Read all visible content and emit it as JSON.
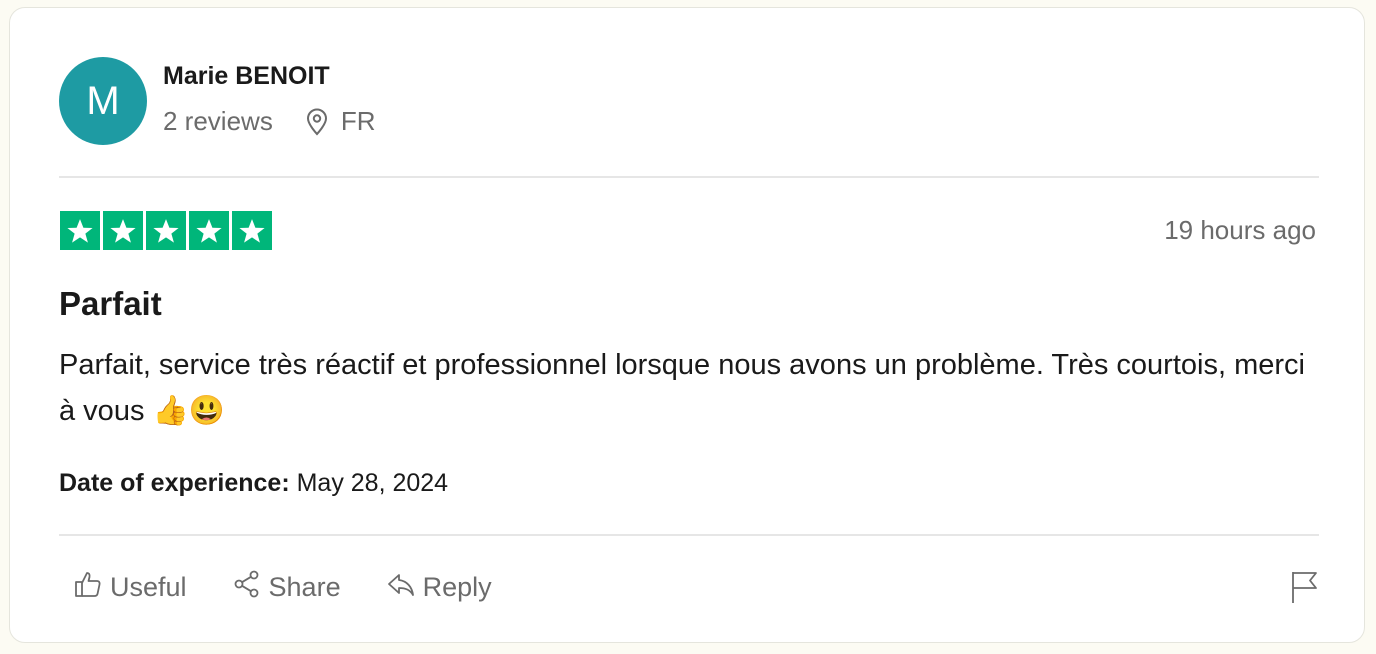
{
  "reviewer": {
    "initial": "M",
    "name": "Marie BENOIT",
    "reviews": "2 reviews",
    "country": "FR",
    "avatar_color": "#1e9ba3"
  },
  "review": {
    "rating": 5,
    "rating_max": 5,
    "star_color": "#00b67a",
    "date": "19 hours ago",
    "title": "Parfait",
    "body": "Parfait, service très réactif et professionnel lorsque nous avons un problème. Très courtois, merci à vous 👍😃",
    "experience_label": "Date of experience:",
    "experience_date": "May 28, 2024"
  },
  "actions": {
    "useful": "Useful",
    "share": "Share",
    "reply": "Reply"
  },
  "icons": {
    "location": "map-pin-icon",
    "useful": "thumbs-up-icon",
    "share": "share-icon",
    "reply": "reply-icon",
    "report": "flag-icon"
  }
}
